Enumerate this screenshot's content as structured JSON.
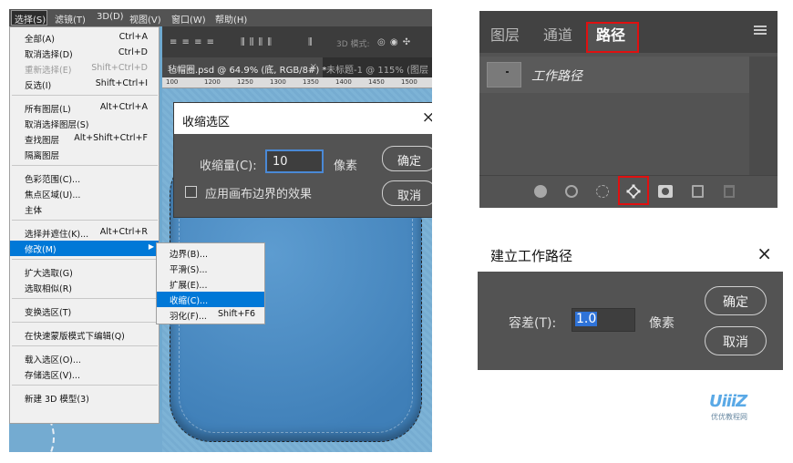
{
  "menubar": {
    "items": [
      "选择(S)",
      "滤镜(T)",
      "3D(D)",
      "视图(V)",
      "窗口(W)",
      "帮助(H)"
    ]
  },
  "optbar": {
    "mode_label": "3D 模式:"
  },
  "doc_tabs": {
    "active": "毡帽圈.psd @ 64.9% (底, RGB/8#) *",
    "active_close": "×",
    "other": "未标题-1 @ 115% (图层"
  },
  "ruler": [
    "100",
    "1200",
    "1250",
    "1300",
    "1350",
    "1400",
    "1450",
    "1500"
  ],
  "select_menu": {
    "items": [
      {
        "label": "全部(A)",
        "shortcut": "Ctrl+A",
        "disabled": false
      },
      {
        "label": "取消选择(D)",
        "shortcut": "Ctrl+D",
        "disabled": false
      },
      {
        "label": "重新选择(E)",
        "shortcut": "Shift+Ctrl+D",
        "disabled": true
      },
      {
        "label": "反选(I)",
        "shortcut": "Shift+Ctrl+I",
        "disabled": false
      },
      {
        "label": "所有图层(L)",
        "shortcut": "Alt+Ctrl+A",
        "disabled": false
      },
      {
        "label": "取消选择图层(S)",
        "shortcut": "",
        "disabled": false
      },
      {
        "label": "查找图层",
        "shortcut": "Alt+Shift+Ctrl+F",
        "disabled": false
      },
      {
        "label": "隔离图层",
        "shortcut": "",
        "disabled": false
      },
      {
        "label": "色彩范围(C)...",
        "shortcut": "",
        "disabled": false
      },
      {
        "label": "焦点区域(U)...",
        "shortcut": "",
        "disabled": false
      },
      {
        "label": "主体",
        "shortcut": "",
        "disabled": false
      },
      {
        "label": "选择并遮住(K)...",
        "shortcut": "Alt+Ctrl+R",
        "disabled": false
      },
      {
        "label": "修改(M)",
        "shortcut": "",
        "disabled": false
      },
      {
        "label": "扩大选取(G)",
        "shortcut": "",
        "disabled": false
      },
      {
        "label": "选取相似(R)",
        "shortcut": "",
        "disabled": false
      },
      {
        "label": "变换选区(T)",
        "shortcut": "",
        "disabled": false
      },
      {
        "label": "在快速蒙版模式下编辑(Q)",
        "shortcut": "",
        "disabled": false
      },
      {
        "label": "载入选区(O)...",
        "shortcut": "",
        "disabled": false
      },
      {
        "label": "存储选区(V)...",
        "shortcut": "",
        "disabled": false
      },
      {
        "label": "新建 3D 模型(3)",
        "shortcut": "",
        "disabled": false
      }
    ],
    "highlighted": "修改(M)"
  },
  "modify_submenu": {
    "items": [
      {
        "label": "边界(B)...",
        "shortcut": ""
      },
      {
        "label": "平滑(S)...",
        "shortcut": ""
      },
      {
        "label": "扩展(E)...",
        "shortcut": ""
      },
      {
        "label": "收缩(C)...",
        "shortcut": ""
      },
      {
        "label": "羽化(F)...",
        "shortcut": "Shift+F6"
      }
    ],
    "highlighted": "收缩(C)..."
  },
  "contract_dialog": {
    "title": "收缩选区",
    "close": "×",
    "field_label": "收缩量(C):",
    "field_value": "10",
    "unit": "像素",
    "checkbox_label": "应用画布边界的效果",
    "checkbox_checked": false,
    "ok": "确定",
    "cancel": "取消"
  },
  "paths_panel": {
    "tabs": [
      "图层",
      "通道",
      "路径"
    ],
    "active_tab": "路径",
    "path_name": "工作路径",
    "bottom_icons": [
      "fill-path-icon",
      "stroke-path-icon",
      "load-selection-icon",
      "make-work-path-icon",
      "add-mask-icon",
      "new-path-icon",
      "delete-path-icon"
    ],
    "highlight_color": "#e01010"
  },
  "make_path_dialog": {
    "title": "建立工作路径",
    "close": "×",
    "field_label": "容差(T):",
    "field_value": "1.0",
    "unit": "像素",
    "ok": "确定",
    "cancel": "取消"
  },
  "watermark": {
    "logo": "UiiiZ",
    "sub": "优优教程网"
  },
  "colors": {
    "menu_highlight": "#0078d7",
    "dialog_bg": "#535353",
    "input_focus": "#4a89d6"
  }
}
